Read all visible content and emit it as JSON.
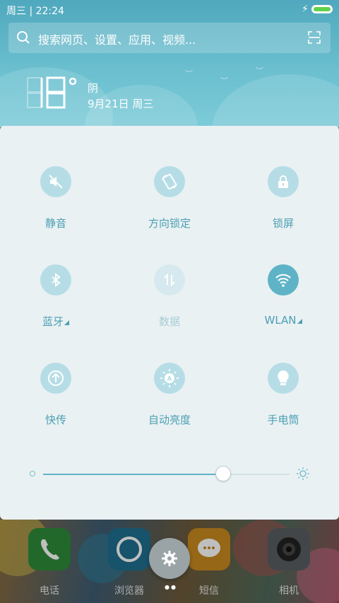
{
  "statusbar": {
    "time": "周三 | 22:24"
  },
  "search": {
    "placeholder": "搜索网页、设置、应用、视频..."
  },
  "weather": {
    "temperature": "18°",
    "condition": "阴",
    "date": "9月21日 周三"
  },
  "toggles": [
    {
      "label": "静音",
      "icon": "mute-icon",
      "state": "off"
    },
    {
      "label": "方向锁定",
      "icon": "rotation-lock-icon",
      "state": "off"
    },
    {
      "label": "锁屏",
      "icon": "lock-icon",
      "state": "off"
    },
    {
      "label": "蓝牙",
      "icon": "bluetooth-icon",
      "state": "off",
      "has_menu": true
    },
    {
      "label": "数据",
      "icon": "mobile-data-icon",
      "state": "disabled"
    },
    {
      "label": "WLAN",
      "icon": "wifi-icon",
      "state": "on",
      "has_menu": true
    },
    {
      "label": "快传",
      "icon": "quick-transfer-icon",
      "state": "off"
    },
    {
      "label": "自动亮度",
      "icon": "auto-brightness-icon",
      "state": "off"
    },
    {
      "label": "手电筒",
      "icon": "flashlight-icon",
      "state": "off"
    }
  ],
  "brightness": {
    "level": 0.73
  },
  "dock": [
    {
      "label": "电话",
      "icon": "phone-icon"
    },
    {
      "label": "浏览器",
      "icon": "browser-icon"
    },
    {
      "label": "短信",
      "icon": "message-icon"
    },
    {
      "label": "相机",
      "icon": "camera-icon"
    }
  ],
  "colors": {
    "accent": "#5fb3c7",
    "label": "#4b9fb3",
    "panel": "#eaf1f3",
    "header": "#5cb2c6"
  }
}
